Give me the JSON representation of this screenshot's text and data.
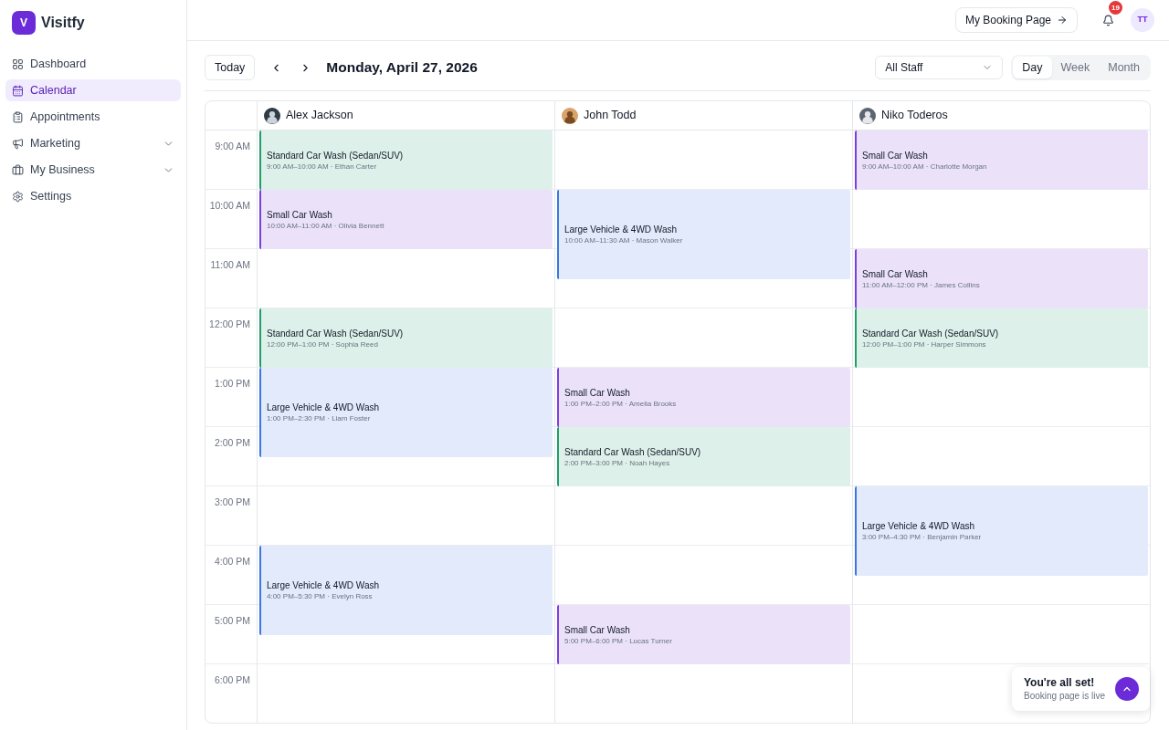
{
  "app": {
    "logo_letter": "V",
    "name": "Visitfy"
  },
  "sidebar": {
    "items": [
      {
        "label": "Dashboard",
        "selected": false,
        "has_submenu": false
      },
      {
        "label": "Calendar",
        "selected": true,
        "has_submenu": false
      },
      {
        "label": "Appointments",
        "selected": false,
        "has_submenu": false
      },
      {
        "label": "Marketing",
        "selected": false,
        "has_submenu": true
      },
      {
        "label": "My Business",
        "selected": false,
        "has_submenu": true
      },
      {
        "label": "Settings",
        "selected": false,
        "has_submenu": false
      }
    ]
  },
  "topbar": {
    "booking_button": "My Booking Page",
    "notification_count": "19",
    "avatar_initials": "TT"
  },
  "toolbar": {
    "today_button": "Today",
    "date_title": "Monday, April 27, 2026",
    "staff_filter": {
      "value": "All Staff"
    },
    "views": [
      {
        "label": "Day",
        "selected": true
      },
      {
        "label": "Week",
        "selected": false
      },
      {
        "label": "Month",
        "selected": false
      }
    ]
  },
  "calendar": {
    "times": [
      "9:00 AM",
      "10:00 AM",
      "11:00 AM",
      "12:00 PM",
      "1:00 PM",
      "2:00 PM",
      "3:00 PM",
      "4:00 PM",
      "5:00 PM",
      "6:00 PM"
    ],
    "staff": [
      {
        "name": "Alex Jackson",
        "events": [
          {
            "title": "Standard Car Wash (Sedan/SUV)",
            "details": "9:00 AM–10:00 AM · Ethan Carter",
            "color": "#1f9d6b"
          },
          {
            "title": "Small Car Wash",
            "details": "10:00 AM–11:00 AM · Olivia Bennett",
            "color": "#7a3fe0"
          },
          {
            "title": "Standard Car Wash (Sedan/SUV)",
            "details": "12:00 PM–1:00 PM · Sophia Reed",
            "color": "#1f9d6b"
          },
          {
            "title": "Large Vehicle & 4WD Wash",
            "details": "1:00 PM–2:30 PM · Liam Foster",
            "color": "#3b76e1"
          },
          {
            "title": "Large Vehicle & 4WD Wash",
            "details": "4:00 PM–5:30 PM · Evelyn Ross",
            "color": "#3b76e1"
          }
        ]
      },
      {
        "name": "John Todd",
        "events": [
          {
            "title": "Large Vehicle & 4WD Wash",
            "details": "10:00 AM–11:30 AM · Mason Walker",
            "color": "#3b76e1"
          },
          {
            "title": "Small Car Wash",
            "details": "1:00 PM–2:00 PM · Amelia Brooks",
            "color": "#7a3fe0"
          },
          {
            "title": "Standard Car Wash (Sedan/SUV)",
            "details": "2:00 PM–3:00 PM · Noah Hayes",
            "color": "#1f9d6b"
          },
          {
            "title": "Small Car Wash",
            "details": "5:00 PM–6:00 PM · Lucas Turner",
            "color": "#7a3fe0"
          }
        ]
      },
      {
        "name": "Niko Toderos",
        "events": [
          {
            "title": "Small Car Wash",
            "details": "9:00 AM–10:00 AM · Charlotte Morgan",
            "color": "#7a3fe0"
          },
          {
            "title": "Small Car Wash",
            "details": "11:00 AM–12:00 PM · James Collins",
            "color": "#7a3fe0"
          },
          {
            "title": "Standard Car Wash (Sedan/SUV)",
            "details": "12:00 PM–1:00 PM · Harper Simmons",
            "color": "#1f9d6b"
          },
          {
            "title": "Large Vehicle & 4WD Wash",
            "details": "3:00 PM–4:30 PM · Benjamin Parker",
            "color": "#3b76e1"
          }
        ]
      }
    ]
  },
  "toast": {
    "title": "You're all set!",
    "message": "Booking page is live"
  }
}
